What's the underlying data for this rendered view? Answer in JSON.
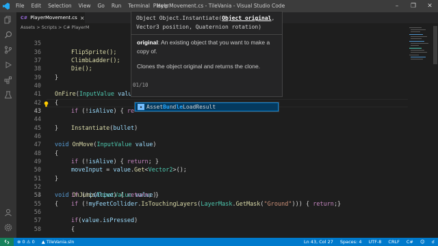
{
  "window": {
    "title": "PlayerMovement.cs - TileVania - Visual Studio Code",
    "menu": [
      "File",
      "Edit",
      "Selection",
      "View",
      "Go",
      "Run",
      "Terminal",
      "Help"
    ]
  },
  "tab": {
    "label": "PlayerMovement.cs",
    "icon_text": "C#"
  },
  "breadcrumb": "Assets > Scripts > C# PlayerM",
  "editor": {
    "lines": [
      {
        "num": "35"
      },
      {
        "num": "36"
      },
      {
        "num": "37"
      },
      {
        "num": "38"
      },
      {
        "num": "39"
      },
      {
        "num": "40"
      },
      {
        "num": "41"
      },
      {
        "num": "42"
      },
      {
        "num": "43"
      },
      {
        "num": "44"
      },
      {
        "num": "45"
      },
      {
        "num": "46"
      },
      {
        "num": "47"
      },
      {
        "num": "48"
      },
      {
        "num": "49"
      },
      {
        "num": "50"
      },
      {
        "num": "51"
      },
      {
        "num": "52"
      },
      {
        "num": "53"
      },
      {
        "num": "54"
      },
      {
        "num": "55"
      },
      {
        "num": "56"
      },
      {
        "num": "57"
      },
      {
        "num": "58"
      }
    ],
    "code": {
      "l35": "FlipSprite();",
      "l36": "ClimbLadder();",
      "l37": "Die();",
      "l40_fn": "OnFire",
      "l40_type": "InputValue",
      "l40_param": "valu",
      "l42_rest": "re",
      "l43_fn": "Instantiate",
      "l43_arg": "bullet",
      "l46_fn": "OnMove",
      "l46_type": "InputValue",
      "l46_param": "value",
      "l48_ret": "return",
      "l49_a": "moveInput",
      "l49_b": "value",
      "l49_get": "Get",
      "l49_t": "Vector2",
      "l52_fn": "OnJump",
      "l52_type": "InputValue",
      "l52_param": "value",
      "l55_field": "myFeetCollider",
      "l55_method": "IsTouchingLayers",
      "l55_cls": "LayerMask",
      "l55_mask": "GetMask",
      "l55_str": "\"Ground\"",
      "l57_value": "value",
      "l57_prop": "isPressed"
    }
  },
  "param_info": {
    "sig_pre": "Object Object.Instantiate(",
    "sig_active": "Object original",
    "sig_post": ", Vector3 position, Quaternion rotation)",
    "param_name": "original",
    "param_desc": ": An existing object that you want to make a copy of.",
    "summary": "Clones the object original and returns the clone.",
    "overload": "01/10"
  },
  "suggest": {
    "items": [
      {
        "pre": "Asset",
        "hl1": "Bu",
        "mid": "nd",
        "hl2": "le",
        "post": "LoadResult",
        "kind": "class"
      }
    ]
  },
  "statusbar": {
    "errors": "0",
    "warnings": "0",
    "project": "TileVania.sln",
    "position": "Ln 43, Col 27",
    "spaces": "Spaces: 4",
    "encoding": "UTF-8",
    "eol": "CRLF",
    "language": "C#"
  },
  "colors": {
    "accent": "#007acc",
    "background": "#1e1e1e",
    "keyword": "#569cd6",
    "type": "#4ec9b0",
    "function": "#dcdcaa"
  }
}
